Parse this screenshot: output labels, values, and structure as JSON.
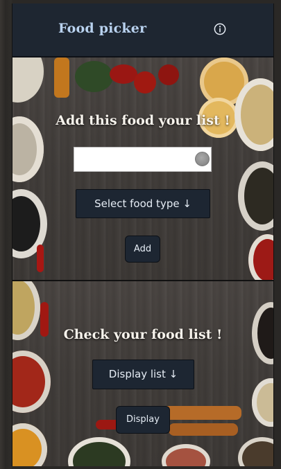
{
  "header": {
    "title": "Food picker",
    "info_icon": "info-circle-icon"
  },
  "add_section": {
    "title": "Add this food your list !",
    "food_input": {
      "value": "",
      "placeholder": ""
    },
    "select_type_label": "Select food type ↓",
    "add_label": "Add"
  },
  "list_section": {
    "title": "Check your food list !",
    "display_list_label": "Display list ↓",
    "display_label": "Display"
  },
  "colors": {
    "header_bg": "#1e2631",
    "title_color": "#b9d2ef",
    "button_bg": "#1d2632",
    "button_text": "#e6edf5"
  }
}
